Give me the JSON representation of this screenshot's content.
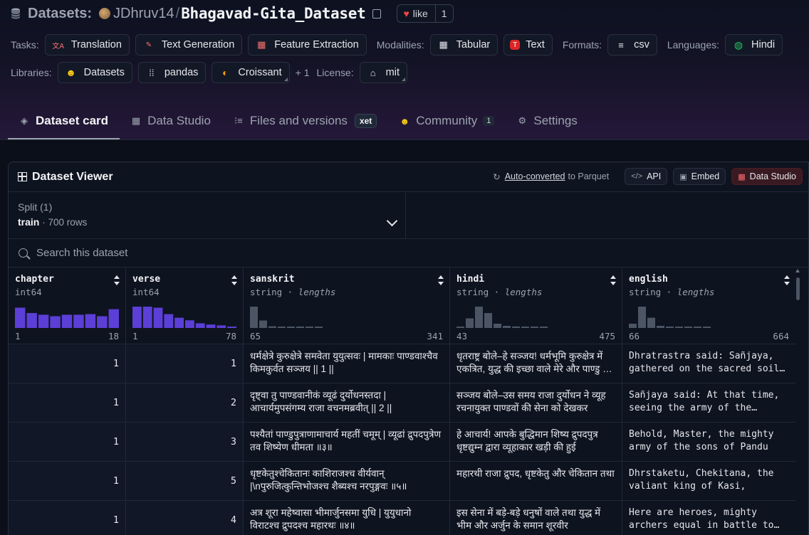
{
  "header": {
    "section": "Datasets:",
    "owner": "JDhruv14",
    "repo": "Bhagavad-Gita_Dataset",
    "like_label": "like",
    "like_count": "1"
  },
  "tags_row1": {
    "tasks_label": "Tasks:",
    "tasks": [
      "Translation",
      "Text Generation",
      "Feature Extraction"
    ],
    "modalities_label": "Modalities:",
    "modalities": [
      "Tabular",
      "Text"
    ],
    "formats_label": "Formats:",
    "formats": [
      "csv"
    ],
    "languages_label": "Languages:",
    "languages": [
      "Hindi"
    ]
  },
  "tags_row2": {
    "libraries_label": "Libraries:",
    "libraries": [
      "Datasets",
      "pandas",
      "Croissant"
    ],
    "more": "+ 1",
    "license_label": "License:",
    "license": "mit"
  },
  "tabs": [
    {
      "label": "Dataset card"
    },
    {
      "label": "Data Studio"
    },
    {
      "label": "Files and versions",
      "badge": "xet"
    },
    {
      "label": "Community",
      "count": "1"
    },
    {
      "label": "Settings"
    }
  ],
  "viewer": {
    "title": "Dataset Viewer",
    "auto_link": "Auto-converted",
    "auto_suffix": "to Parquet",
    "api_label": "API",
    "embed_label": "Embed",
    "studio_label": "Data Studio",
    "split_label": "Split (1)",
    "split_name": "train",
    "split_rows": "· 700 rows",
    "search_placeholder": "Search this dataset"
  },
  "columns": [
    {
      "name": "chapter",
      "type": "int64",
      "type_suffix": "",
      "min": "1",
      "max": "18",
      "hist": [
        0.95,
        0.7,
        0.62,
        0.55,
        0.62,
        0.62,
        0.65,
        0.55,
        0.88
      ],
      "color": "#5b3fd6"
    },
    {
      "name": "verse",
      "type": "int64",
      "type_suffix": "",
      "min": "1",
      "max": "78",
      "hist": [
        1.0,
        1.0,
        0.95,
        0.65,
        0.48,
        0.36,
        0.22,
        0.16,
        0.12,
        0.05
      ],
      "color": "#5b3fd6"
    },
    {
      "name": "sanskrit",
      "type": "string · ",
      "type_suffix": "lengths",
      "min": "65",
      "max": "341",
      "hist": [
        1.0,
        0.35,
        0.08,
        0.05,
        0.05,
        0.03,
        0.02,
        0.02
      ],
      "color": "#4b5563"
    },
    {
      "name": "hindi",
      "type": "string · ",
      "type_suffix": "lengths",
      "min": "43",
      "max": "475",
      "hist": [
        0.05,
        0.45,
        1.0,
        0.7,
        0.2,
        0.1,
        0.07,
        0.05,
        0.03,
        0.02
      ],
      "color": "#4b5563"
    },
    {
      "name": "english",
      "type": "string · ",
      "type_suffix": "lengths",
      "min": "66",
      "max": "664",
      "hist": [
        0.2,
        1.0,
        0.48,
        0.1,
        0.06,
        0.04,
        0.03,
        0.02,
        0.02
      ],
      "color": "#4b5563"
    }
  ],
  "rows": [
    {
      "chapter": "1",
      "verse": "1",
      "sanskrit": "धर्मक्षेत्रे कुरुक्षेत्रे समवेता युयुत्सवः | मामकाः पाण्डवाश्चैव किमकुर्वत सञ्जय || 1 ||",
      "hindi": "धृतराष्ट्र बोले–हे सञ्जय! धर्मभूमि कुरुक्षेत्र में एकत्रित, युद्ध की इच्छा वाले मेरे और पाण्डु के पुत्रों ने क्या किया?",
      "english": "Dhratrastra said: Sañjaya, gathered on the sacred soil of Kuruksetra"
    },
    {
      "chapter": "1",
      "verse": "2",
      "sanskrit": "दृष्ट्वा तु पाण्डवानीकं व्यूढं दुर्योधनस्तदा | आचार्यमुपसंगम्य राजा वचनमब्रवीत् || 2 ||",
      "hindi": "सञ्जय बोले–उस समय राजा दुर्योधन ने व्यूह रचनायुक्त पाण्डवों की सेना को देखकर",
      "english": "Sañjaya said: At that time, seeing the army of the Pandavas"
    },
    {
      "chapter": "1",
      "verse": "3",
      "sanskrit": "पश्यैतां पाण्डुपुत्राणामाचार्य महतीं चमूम् | व्यूढां द्रुपदपुत्रेण तव शिष्येण धीमता ॥३॥",
      "hindi": "हे आचार्य! आपके बुद्धिमान शिष्य द्रुपदपुत्र धृष्टद्युम्न द्वारा व्यूहाकार खड़ी की हुई",
      "english": "Behold, Master, the mighty army of the sons of Pandu"
    },
    {
      "chapter": "1",
      "verse": "5",
      "sanskrit": "धृष्टकेतुश्चेकितानः काशिराजश्च वीर्यवान् |\\nपुरुजित्कुन्तिभोजश्च शैब्यश्च नरपुङ्गवः ॥५॥",
      "hindi": "महारथी राजा द्रुपद, धृष्टकेतु और चेकितान तथा",
      "english": "Dhrstaketu, Chekitana, the valiant king of Kasi,"
    },
    {
      "chapter": "1",
      "verse": "4",
      "sanskrit": "अत्र शूरा महेष्वासा भीमार्जुनसमा युधि | युयुधानो विराटश्च द्रुपदश्च महारथः ॥४॥",
      "hindi": "इस सेना में बड़े-बड़े धनुषों वाले तथा युद्ध में भीम और अर्जुन के समान शूरवीर",
      "english": "Here are heroes, mighty archers equal in battle to Bhima and Arjuna"
    }
  ],
  "colors": {
    "background": "#0b0f19",
    "accent": "#5b3fd6",
    "like": "#ef4444"
  }
}
